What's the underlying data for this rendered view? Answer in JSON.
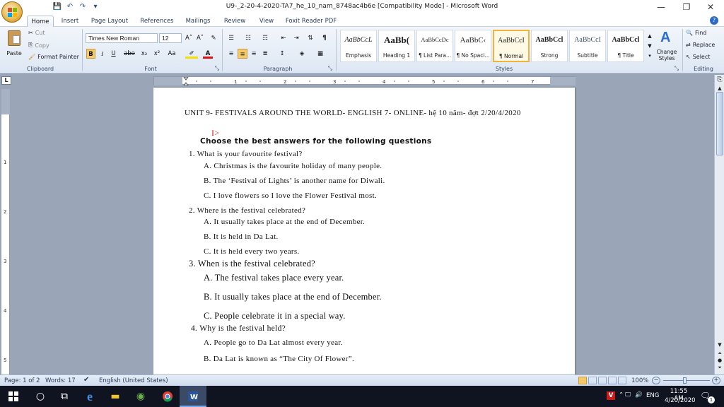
{
  "window": {
    "title": "U9-_2-20-4-2020-TA7_he_10_nam_8748ac4b6e [Compatibility Mode] - Microsoft Word",
    "minimize_glyph": "—",
    "restore_glyph": "❐",
    "close_glyph": "✕"
  },
  "tabs": [
    "Home",
    "Insert",
    "Page Layout",
    "References",
    "Mailings",
    "Review",
    "View",
    "Foxit Reader PDF"
  ],
  "ribbon": {
    "clipboard": {
      "paste": "Paste",
      "cut": "Cut",
      "copy": "Copy",
      "format_painter": "Format Painter",
      "label": "Clipboard"
    },
    "font": {
      "name": "Times New Roman",
      "size": "12",
      "grow": "A˄",
      "shrink": "A˅",
      "bold": "B",
      "italic": "I",
      "underline": "U",
      "strike": "abe",
      "sub": "x₂",
      "sup": "x²",
      "case": "Aa",
      "label": "Font"
    },
    "paragraph": {
      "label": "Paragraph"
    },
    "styles": {
      "label": "Styles",
      "items": [
        {
          "sample": "AaBbCcL",
          "name": "Emphasis"
        },
        {
          "sample": "AaBb(",
          "name": "Heading 1"
        },
        {
          "sample": "AaBbCcDc",
          "name": "¶ List Para..."
        },
        {
          "sample": "AaBbC‹",
          "name": "¶ No Spaci..."
        },
        {
          "sample": "AaBbCcI",
          "name": "¶ Normal"
        },
        {
          "sample": "AaBbCcl",
          "name": "Strong"
        },
        {
          "sample": "AaBbCcI",
          "name": "Subtitle"
        },
        {
          "sample": "AaBbCcl",
          "name": "¶ Title"
        }
      ],
      "change_styles": "Change Styles"
    },
    "editing": {
      "find": "Find",
      "replace": "Replace",
      "select": "Select",
      "label": "Editing"
    }
  },
  "document": {
    "header": "UNIT 9- FESTIVALS AROUND THE WORLD- ENGLISH 7- ONLINE- hệ 10 năm- đợt 2/20/4/2020",
    "section": "I>",
    "instruction": "Choose the best answers for the following questions",
    "lines": [
      "1.  What is your favourite festival?",
      "A. Christmas is the favourite holiday of many people.",
      "B. The ‘Festival of Lights’ is another name for Diwali.",
      "C. I love flowers so I love the Flower Festival most.",
      "2.  Where is the festival celebrated?",
      "A. It usually takes place at the end of December.",
      "B. It is held in Da Lat.",
      "C. It is held every two years.",
      "3.  When is the festival celebrated?",
      "A. The festival takes place every year.",
      "B. It usually takes place at the end of December.",
      "C. People celebrate it in a special way.",
      "4. Why is the festival held?",
      "A. People go to Da Lat almost every year.",
      "B. Da Lat is known as “The City Of Flower”."
    ]
  },
  "status": {
    "page": "Page: 1 of 2",
    "words": "Words: 17",
    "language": "English (United States)",
    "zoom": "100%"
  },
  "taskbar": {
    "time": "11:55 AM",
    "date": "4/20/2020",
    "lang": "ENG",
    "notify_count": "1"
  },
  "colors": {
    "accent": "#2b579a",
    "section_red": "#d11a1a"
  }
}
